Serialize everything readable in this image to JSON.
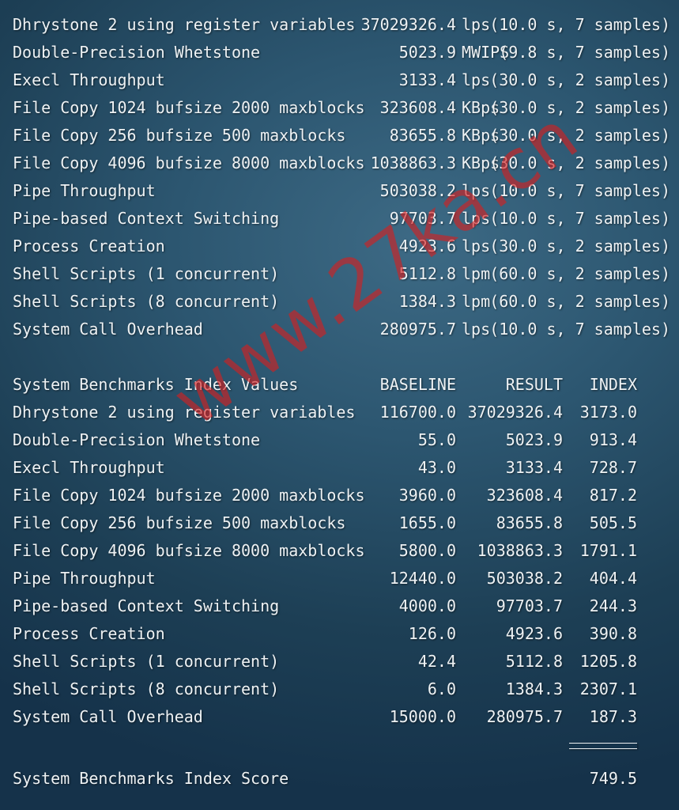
{
  "results": [
    {
      "name": "Dhrystone 2 using register variables",
      "value": "37029326.4",
      "unit": "lps",
      "detail": "(10.0 s, 7 samples)"
    },
    {
      "name": "Double-Precision Whetstone",
      "value": "5023.9",
      "unit": "MWIPS",
      "detail": "(9.8 s, 7 samples)"
    },
    {
      "name": "Execl Throughput",
      "value": "3133.4",
      "unit": "lps",
      "detail": "(30.0 s, 2 samples)"
    },
    {
      "name": "File Copy 1024 bufsize 2000 maxblocks",
      "value": "323608.4",
      "unit": "KBps",
      "detail": "(30.0 s, 2 samples)"
    },
    {
      "name": "File Copy 256 bufsize 500 maxblocks",
      "value": "83655.8",
      "unit": "KBps",
      "detail": "(30.0 s, 2 samples)"
    },
    {
      "name": "File Copy 4096 bufsize 8000 maxblocks",
      "value": "1038863.3",
      "unit": "KBps",
      "detail": "(30.0 s, 2 samples)"
    },
    {
      "name": "Pipe Throughput",
      "value": "503038.2",
      "unit": "lps",
      "detail": "(10.0 s, 7 samples)"
    },
    {
      "name": "Pipe-based Context Switching",
      "value": "97703.7",
      "unit": "lps",
      "detail": "(10.0 s, 7 samples)"
    },
    {
      "name": "Process Creation",
      "value": "4923.6",
      "unit": "lps",
      "detail": "(30.0 s, 2 samples)"
    },
    {
      "name": "Shell Scripts (1 concurrent)",
      "value": "5112.8",
      "unit": "lpm",
      "detail": "(60.0 s, 2 samples)"
    },
    {
      "name": "Shell Scripts (8 concurrent)",
      "value": "1384.3",
      "unit": "lpm",
      "detail": "(60.0 s, 2 samples)"
    },
    {
      "name": "System Call Overhead",
      "value": "280975.7",
      "unit": "lps",
      "detail": "(10.0 s, 7 samples)"
    }
  ],
  "index": {
    "header": {
      "title": "System Benchmarks Index Values",
      "baseline": "BASELINE",
      "result": "RESULT",
      "index": "INDEX"
    },
    "rows": [
      {
        "name": "Dhrystone 2 using register variables",
        "baseline": "116700.0",
        "result": "37029326.4",
        "index": "3173.0"
      },
      {
        "name": "Double-Precision Whetstone",
        "baseline": "55.0",
        "result": "5023.9",
        "index": "913.4"
      },
      {
        "name": "Execl Throughput",
        "baseline": "43.0",
        "result": "3133.4",
        "index": "728.7"
      },
      {
        "name": "File Copy 1024 bufsize 2000 maxblocks",
        "baseline": "3960.0",
        "result": "323608.4",
        "index": "817.2"
      },
      {
        "name": "File Copy 256 bufsize 500 maxblocks",
        "baseline": "1655.0",
        "result": "83655.8",
        "index": "505.5"
      },
      {
        "name": "File Copy 4096 bufsize 8000 maxblocks",
        "baseline": "5800.0",
        "result": "1038863.3",
        "index": "1791.1"
      },
      {
        "name": "Pipe Throughput",
        "baseline": "12440.0",
        "result": "503038.2",
        "index": "404.4"
      },
      {
        "name": "Pipe-based Context Switching",
        "baseline": "4000.0",
        "result": "97703.7",
        "index": "244.3"
      },
      {
        "name": "Process Creation",
        "baseline": "126.0",
        "result": "4923.6",
        "index": "390.8"
      },
      {
        "name": "Shell Scripts (1 concurrent)",
        "baseline": "42.4",
        "result": "5112.8",
        "index": "1205.8"
      },
      {
        "name": "Shell Scripts (8 concurrent)",
        "baseline": "6.0",
        "result": "1384.3",
        "index": "2307.1"
      },
      {
        "name": "System Call Overhead",
        "baseline": "15000.0",
        "result": "280975.7",
        "index": "187.3"
      }
    ],
    "divider": "========",
    "score_label": "System Benchmarks Index Score",
    "score_value": "749.5"
  },
  "watermark": {
    "text": "www.27ka.cn",
    "color": "#d41e1e"
  },
  "theme": {
    "background": "#2c5670",
    "text": "#eef2f4"
  }
}
